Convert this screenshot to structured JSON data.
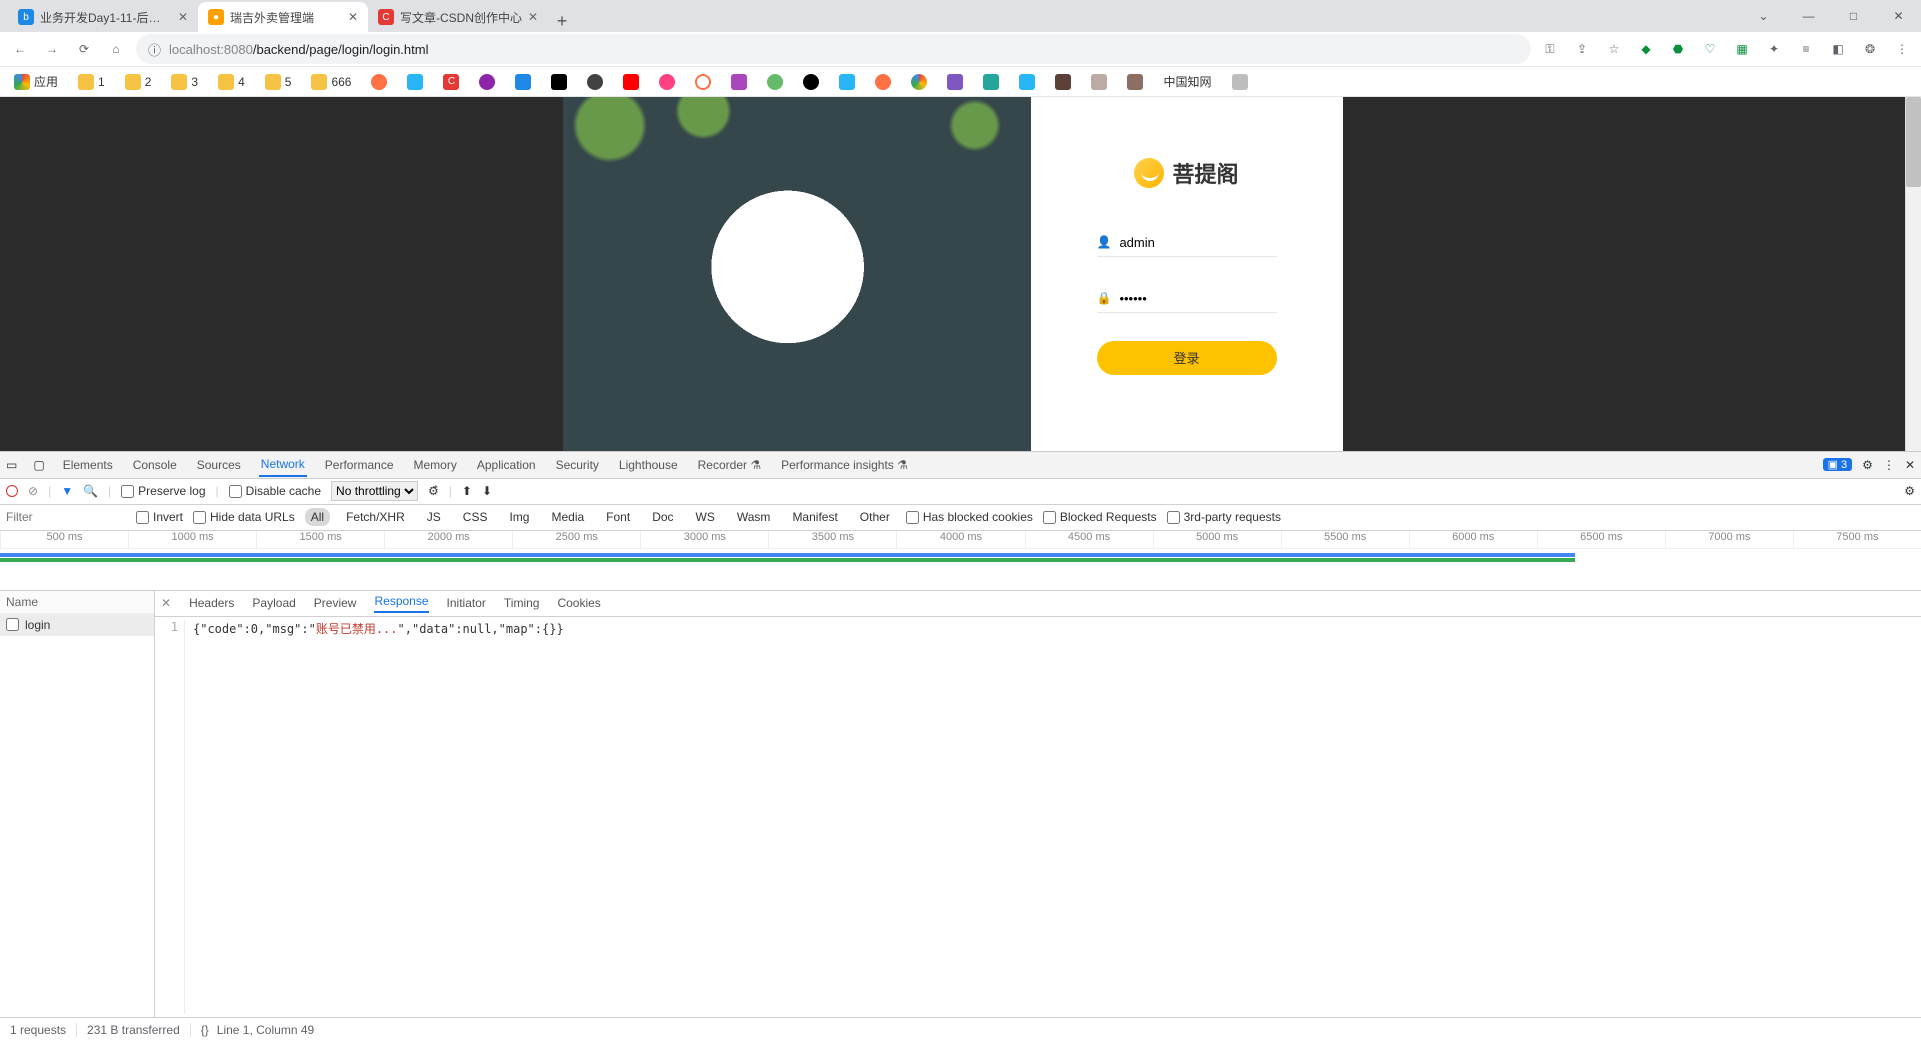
{
  "browser": {
    "tabs": [
      {
        "label": "业务开发Day1-11-后台系统登录",
        "favicon_bg": "#1e88e5"
      },
      {
        "label": "瑞吉外卖管理端",
        "favicon_bg": "#ffa000"
      },
      {
        "label": "写文章-CSDN创作中心",
        "favicon_bg": "#e53935"
      }
    ],
    "url_plain": "localhost:8080",
    "url_rest": "/backend/page/login/login.html",
    "window_controls": {
      "dropdown": "⌄",
      "min": "—",
      "max": "□",
      "close": "✕"
    }
  },
  "bookmarks": {
    "apps": "应用",
    "folders": [
      "1",
      "2",
      "3",
      "4",
      "5",
      "666"
    ],
    "zhiwang": "中国知网"
  },
  "login": {
    "brand": "菩提阁",
    "username_value": "admin",
    "password_value": "••••••",
    "submit_label": "登录"
  },
  "devtools": {
    "tabs": [
      "Elements",
      "Console",
      "Sources",
      "Network",
      "Performance",
      "Memory",
      "Application",
      "Security",
      "Lighthouse",
      "Recorder ⚗",
      "Performance insights ⚗"
    ],
    "active_tab": "Network",
    "issue_badge_icon": "▣",
    "issue_count": "3",
    "subbar": {
      "preserve_log": "Preserve log",
      "disable_cache": "Disable cache",
      "throttling": "No throttling"
    },
    "filter_placeholder": "Filter",
    "invert": "Invert",
    "hide_data_urls": "Hide data URLs",
    "types": [
      "All",
      "Fetch/XHR",
      "JS",
      "CSS",
      "Img",
      "Media",
      "Font",
      "Doc",
      "WS",
      "Wasm",
      "Manifest",
      "Other"
    ],
    "blocked_cookies": "Has blocked cookies",
    "blocked_requests": "Blocked Requests",
    "third_party": "3rd-party requests",
    "ruler": [
      "500 ms",
      "1000 ms",
      "1500 ms",
      "2000 ms",
      "2500 ms",
      "3000 ms",
      "3500 ms",
      "4000 ms",
      "4500 ms",
      "5000 ms",
      "5500 ms",
      "6000 ms",
      "6500 ms",
      "7000 ms",
      "7500 ms"
    ],
    "name_header": "Name",
    "requests": [
      "login"
    ],
    "detail_tabs": [
      "Headers",
      "Payload",
      "Preview",
      "Response",
      "Initiator",
      "Timing",
      "Cookies"
    ],
    "active_detail_tab": "Response",
    "response_line_no": "1",
    "response_pre": "{\"code\":0,\"msg\":\"",
    "response_msg": "账号已禁用...",
    "response_post": "\",\"data\":null,\"map\":{}}",
    "status": {
      "requests": "1 requests",
      "transferred": "231 B transferred",
      "brackets": "{}",
      "cursor": "Line 1, Column 49"
    }
  }
}
